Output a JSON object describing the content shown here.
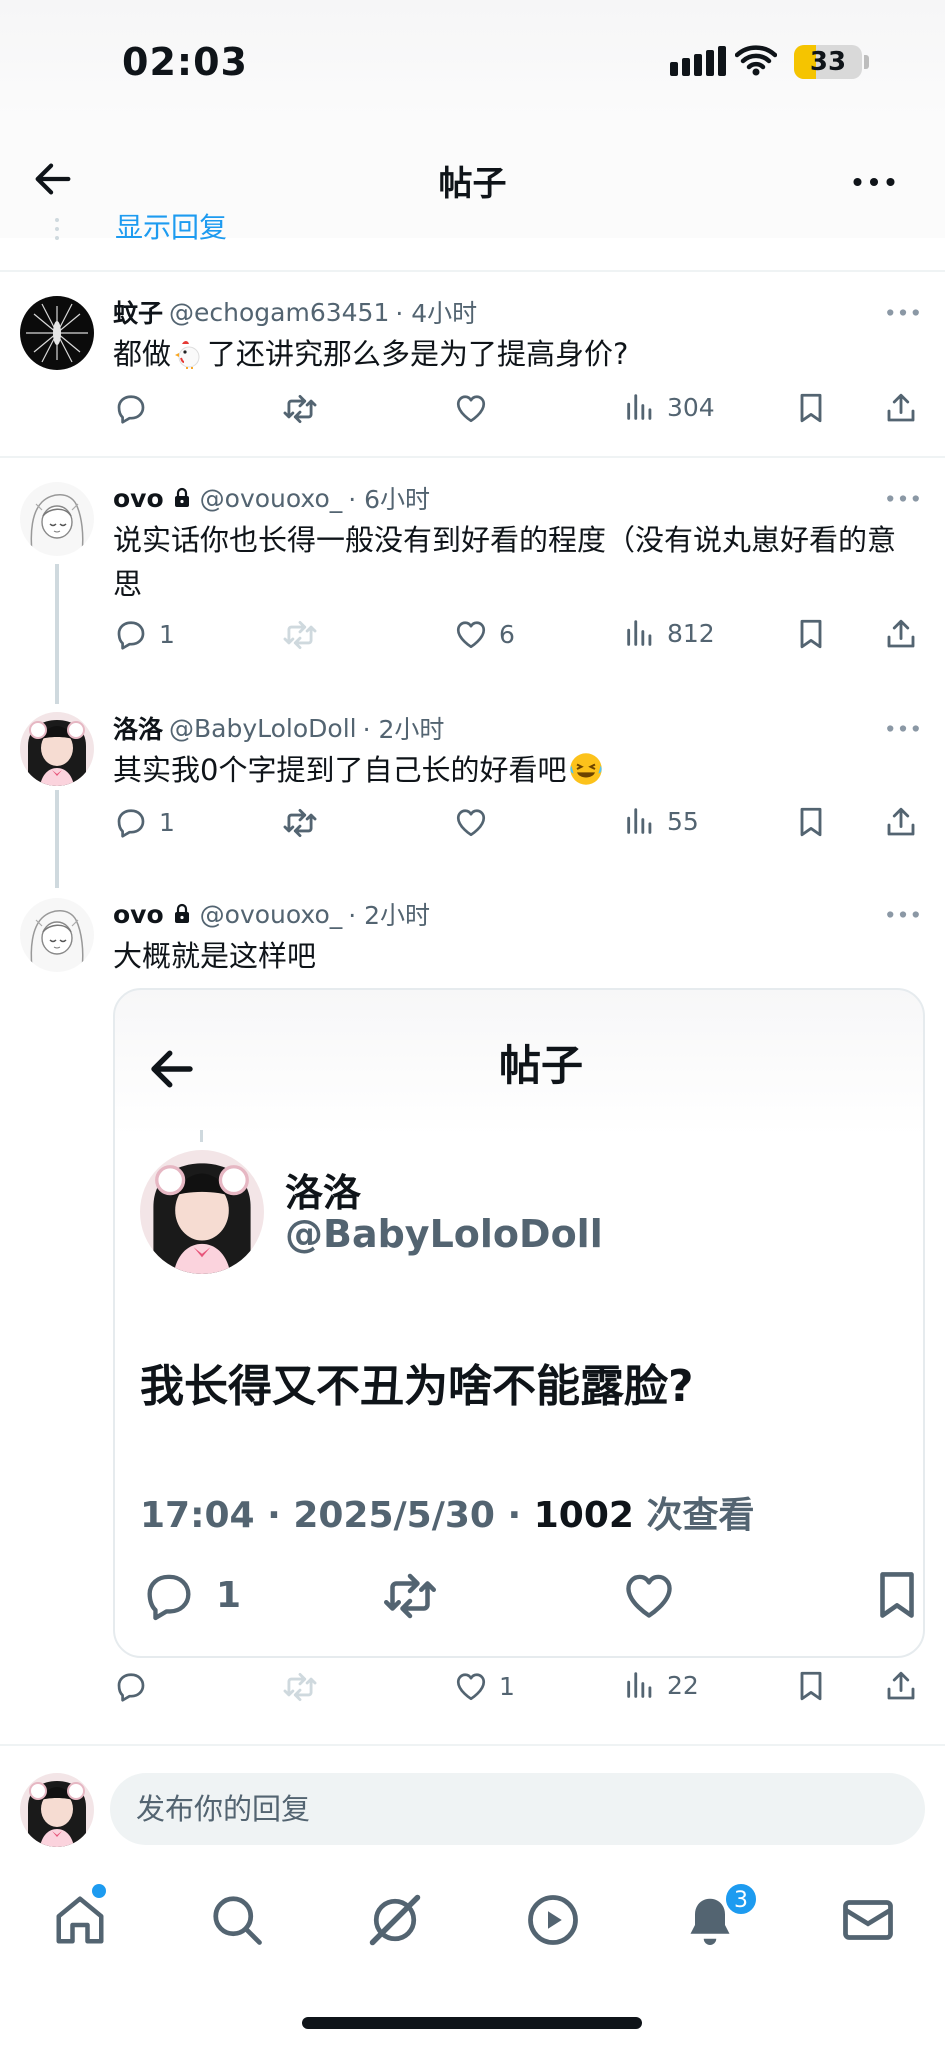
{
  "status_bar": {
    "time": "02:03",
    "battery": "33",
    "battery_level": 0.33
  },
  "header": {
    "title": "帖子"
  },
  "peek_text": "显示回复",
  "tweets": [
    {
      "name": "蚊子",
      "handle": "@echogam63451",
      "time": "· 4小时",
      "text_before": "都做",
      "text_after": "了还讲究那么多是为了提高身价?",
      "replies": "",
      "likes": "",
      "views": "304"
    },
    {
      "name": "ovo",
      "handle": "@ovouoxo_",
      "time": "· 6小时",
      "text": "说实话你也长得一般没有到好看的程度（没有说丸崽好看的意思",
      "replies": "1",
      "likes": "6",
      "views": "812"
    },
    {
      "name": "洛洛",
      "handle": "@BabyLoloDoll",
      "time": "· 2小时",
      "text": "其实我0个字提到了自己长的好看吧",
      "replies": "1",
      "likes": "",
      "views": "55"
    },
    {
      "name": "ovo",
      "handle": "@ovouoxo_",
      "time": "· 2小时",
      "text": "大概就是这样吧",
      "replies": "",
      "likes": "1",
      "views": "22"
    }
  ],
  "quote": {
    "title": "帖子",
    "name": "洛洛",
    "handle": "@BabyLoloDoll",
    "body": "我长得又不丑为啥不能露脸?",
    "stamp_time": "17:04 · 2025/5/30 ·",
    "stamp_views": "1002",
    "stamp_label": "次查看",
    "replies": "1"
  },
  "reply_bar": {
    "placeholder": "发布你的回复"
  },
  "nav": {
    "notifications_badge": "3"
  },
  "icons": [
    "back-arrow-icon",
    "more-icon",
    "reply-icon",
    "retweet-icon",
    "like-icon",
    "views-icon",
    "bookmark-icon",
    "share-icon",
    "lock-icon",
    "home-icon",
    "search-icon",
    "grok-icon",
    "video-icon",
    "bell-icon",
    "mail-icon"
  ],
  "colors": {
    "accent": "#1d9bf0",
    "text": "#0f1419",
    "muted": "#536471"
  }
}
